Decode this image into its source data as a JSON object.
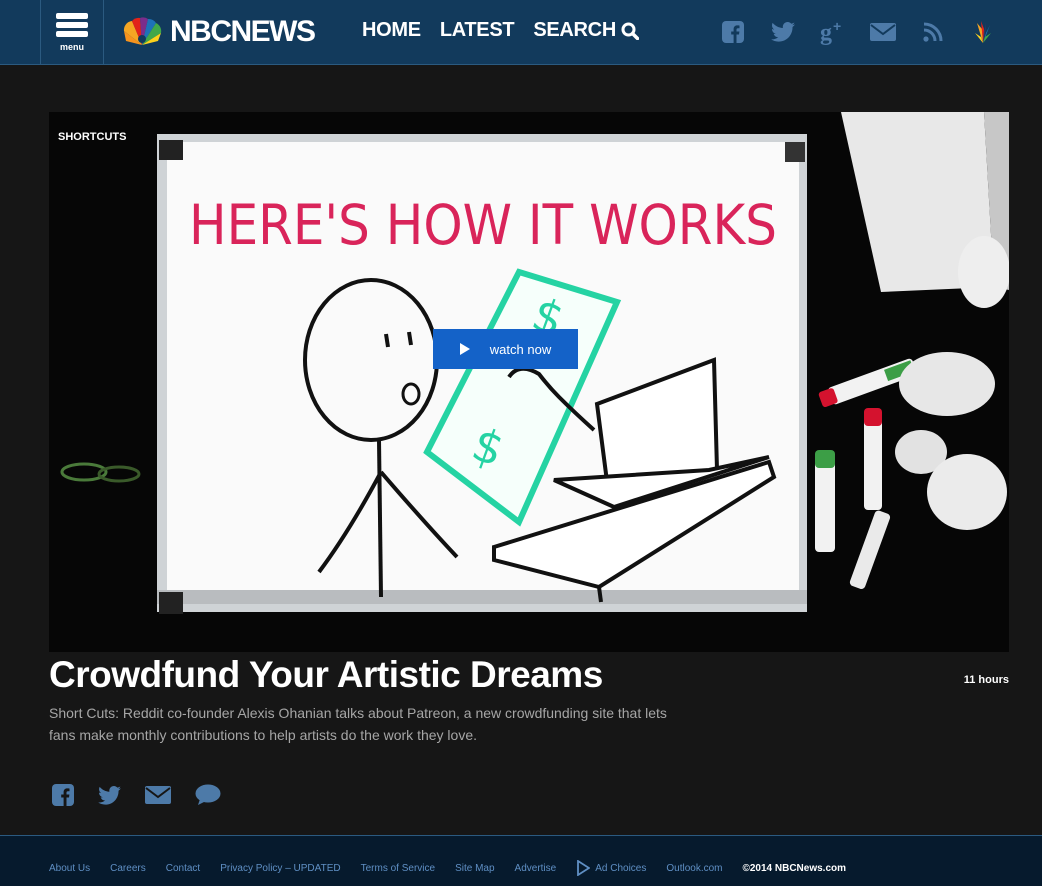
{
  "header": {
    "menu_label": "menu",
    "logo_text": "NBCNEWS",
    "nav": [
      "HOME",
      "LATEST",
      "SEARCH"
    ],
    "social": [
      "facebook-icon",
      "twitter-icon",
      "google-plus-icon",
      "email-icon",
      "rss-icon",
      "peacock-icon"
    ]
  },
  "hero": {
    "section_label": "SHORTCUTS",
    "whiteboard_text": "HERE'S HOW IT WORKS",
    "watch_label": "watch now"
  },
  "article": {
    "title": "Crowdfund Your Artistic Dreams",
    "time": "11 hours",
    "description": "Short Cuts: Reddit co-founder Alexis Ohanian talks about Patreon, a new crowdfunding site that lets fans make monthly contributions to help artists do the work they love.",
    "share": [
      "facebook-icon",
      "twitter-icon",
      "email-icon",
      "comment-icon"
    ]
  },
  "footer": {
    "links": [
      "About Us",
      "Careers",
      "Contact",
      "Privacy Policy – UPDATED",
      "Terms of Service",
      "Site Map",
      "Advertise",
      "Ad Choices",
      "Outlook.com"
    ],
    "copyright": "©2014 NBCNews.com"
  },
  "colors": {
    "header_bg": "#123a5c",
    "accent_blue": "#1462c8",
    "footer_link": "#5f8fc4",
    "page_bg": "#161616"
  }
}
